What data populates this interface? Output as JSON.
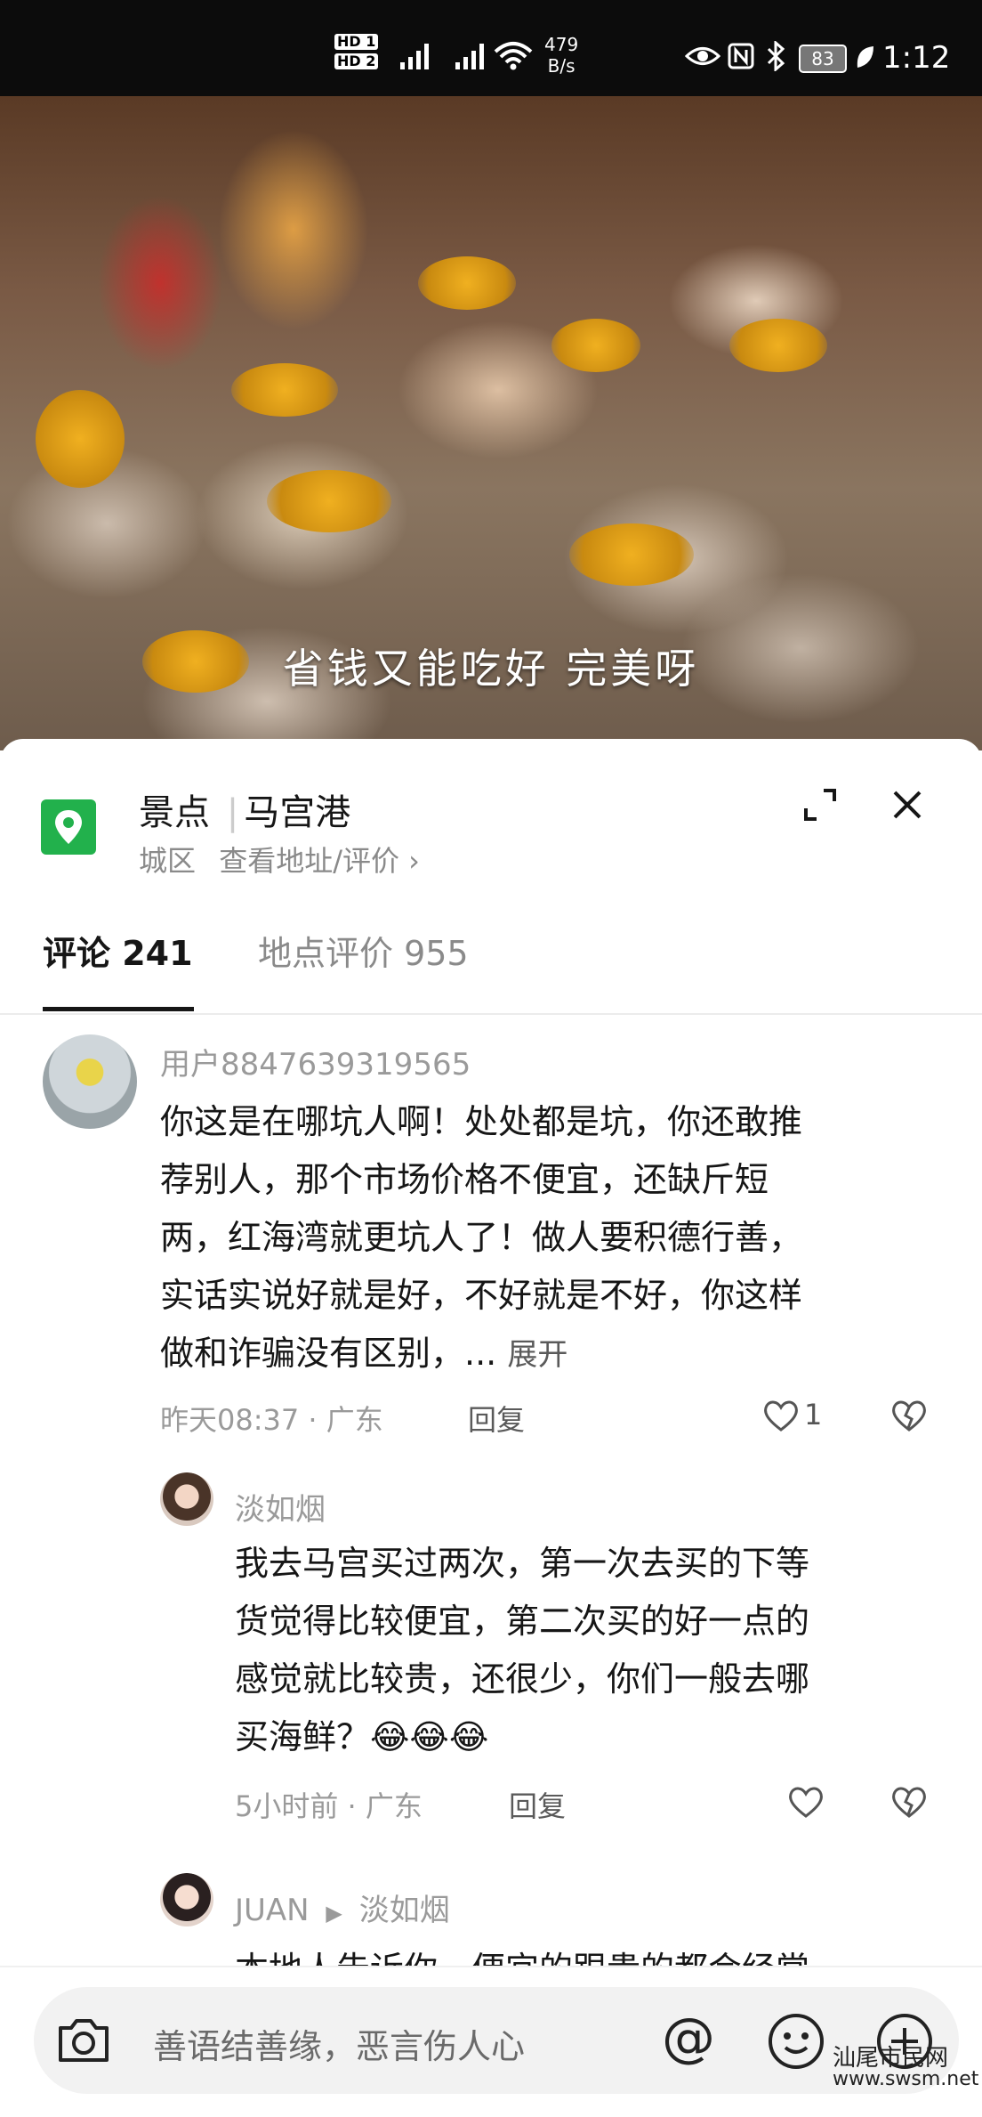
{
  "status_bar": {
    "hd1": "HD 1",
    "hd2": "HD 2",
    "net_speed_value": "479",
    "net_speed_unit": "B/s",
    "battery": "83",
    "time": "1:12"
  },
  "video": {
    "caption": "省钱又能吃好 完美呀"
  },
  "location": {
    "category": "景点",
    "name": "马宫港",
    "district": "城区",
    "address_link": "查看地址/评价",
    "icon": "map-pin-icon"
  },
  "tabs": [
    {
      "label": "评论 241",
      "active": true
    },
    {
      "label": "地点评价 955",
      "active": false
    }
  ],
  "comments": [
    {
      "user": "用户8847639319565",
      "text_lines": [
        "你这是在哪坑人啊！处处都是坑，你还敢推",
        "荐别人，那个市场价格不便宜，还缺斤短",
        "两，红海湾就更坑人了！做人要积德行善，",
        "实话实说好就是好，不好就是不好，你这样",
        "做和诈骗没有区别，..."
      ],
      "expand": "展开",
      "time": "昨天08:37",
      "region": "广东",
      "reply": "回复",
      "likes": "1"
    },
    {
      "user": "淡如烟",
      "text_lines": [
        "我去马宫买过两次，第一次去买的下等",
        "货觉得比较便宜，第二次买的好一点的",
        "感觉就比较贵，还很少，你们一般去哪",
        "买海鲜？"
      ],
      "emoji": "😂😂😂",
      "time": "5小时前",
      "region": "广东",
      "reply": "回复"
    },
    {
      "user": "JUAN",
      "reply_to": "淡如烟",
      "text_partial": "本地人告诉你，便宜的跟贵的都会经常"
    }
  ],
  "input": {
    "placeholder": "善语结善缘，恶言伤人心",
    "at": "@"
  },
  "watermark": {
    "line1": "汕尾市民网",
    "line2": "www.swsm.net"
  },
  "colors": {
    "accent_green": "#22b14c",
    "status_bg": "#0c0c0c"
  }
}
